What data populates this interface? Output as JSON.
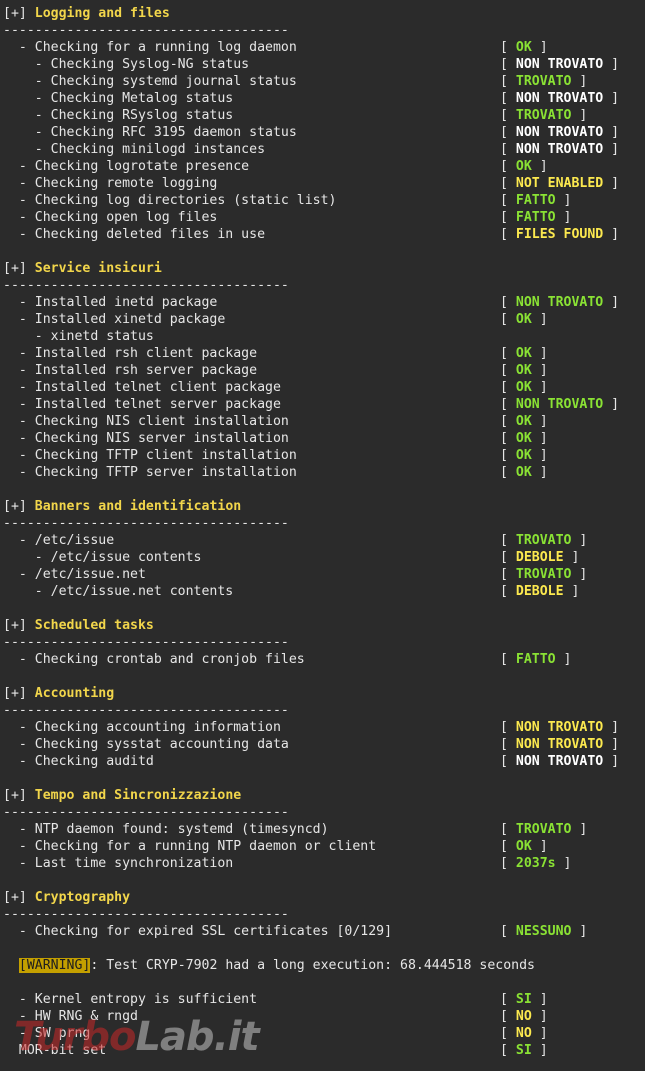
{
  "sections": [
    {
      "tag": "[+]",
      "title": "Logging and files",
      "rule": "------------------------------------",
      "items": [
        {
          "label": "  - Checking for a running log daemon",
          "status": "OK",
          "color": "green"
        },
        {
          "label": "    - Checking Syslog-NG status",
          "status": "NON TROVATO",
          "color": "white"
        },
        {
          "label": "    - Checking systemd journal status",
          "status": "TROVATO",
          "color": "green"
        },
        {
          "label": "    - Checking Metalog status",
          "status": "NON TROVATO",
          "color": "white"
        },
        {
          "label": "    - Checking RSyslog status",
          "status": "TROVATO",
          "color": "green"
        },
        {
          "label": "    - Checking RFC 3195 daemon status",
          "status": "NON TROVATO",
          "color": "white"
        },
        {
          "label": "    - Checking minilogd instances",
          "status": "NON TROVATO",
          "color": "white"
        },
        {
          "label": "  - Checking logrotate presence",
          "status": "OK",
          "color": "green"
        },
        {
          "label": "  - Checking remote logging",
          "status": "NOT ENABLED",
          "color": "yellow"
        },
        {
          "label": "  - Checking log directories (static list)",
          "status": "FATTO",
          "color": "green"
        },
        {
          "label": "  - Checking open log files",
          "status": "FATTO",
          "color": "green"
        },
        {
          "label": "  - Checking deleted files in use",
          "status": "FILES FOUND",
          "color": "yellow"
        }
      ]
    },
    {
      "tag": "[+]",
      "title": "Service insicuri",
      "rule": "------------------------------------",
      "items": [
        {
          "label": "  - Installed inetd package",
          "status": "NON TROVATO",
          "color": "green"
        },
        {
          "label": "  - Installed xinetd package",
          "status": "OK",
          "color": "green"
        },
        {
          "label": "    - xinetd status",
          "status": "",
          "color": "white"
        },
        {
          "label": "  - Installed rsh client package",
          "status": "OK",
          "color": "green"
        },
        {
          "label": "  - Installed rsh server package",
          "status": "OK",
          "color": "green"
        },
        {
          "label": "  - Installed telnet client package",
          "status": "OK",
          "color": "green"
        },
        {
          "label": "  - Installed telnet server package",
          "status": "NON TROVATO",
          "color": "green"
        },
        {
          "label": "  - Checking NIS client installation",
          "status": "OK",
          "color": "green"
        },
        {
          "label": "  - Checking NIS server installation",
          "status": "OK",
          "color": "green"
        },
        {
          "label": "  - Checking TFTP client installation",
          "status": "OK",
          "color": "green"
        },
        {
          "label": "  - Checking TFTP server installation",
          "status": "OK",
          "color": "green"
        }
      ]
    },
    {
      "tag": "[+]",
      "title": "Banners and identification",
      "rule": "------------------------------------",
      "items": [
        {
          "label": "  - /etc/issue",
          "status": "TROVATO",
          "color": "green"
        },
        {
          "label": "    - /etc/issue contents",
          "status": "DEBOLE",
          "color": "yellow"
        },
        {
          "label": "  - /etc/issue.net",
          "status": "TROVATO",
          "color": "green"
        },
        {
          "label": "    - /etc/issue.net contents",
          "status": "DEBOLE",
          "color": "yellow"
        }
      ]
    },
    {
      "tag": "[+]",
      "title": "Scheduled tasks",
      "rule": "------------------------------------",
      "items": [
        {
          "label": "  - Checking crontab and cronjob files",
          "status": "FATTO",
          "color": "green"
        }
      ]
    },
    {
      "tag": "[+]",
      "title": "Accounting",
      "rule": "------------------------------------",
      "items": [
        {
          "label": "  - Checking accounting information",
          "status": "NON TROVATO",
          "color": "yellow"
        },
        {
          "label": "  - Checking sysstat accounting data",
          "status": "NON TROVATO",
          "color": "yellow"
        },
        {
          "label": "  - Checking auditd",
          "status": "NON TROVATO",
          "color": "white"
        }
      ]
    },
    {
      "tag": "[+]",
      "title": "Tempo and Sincronizzazione",
      "rule": "------------------------------------",
      "items": [
        {
          "label": "  - NTP daemon found: systemd (timesyncd)",
          "status": "TROVATO",
          "color": "green"
        },
        {
          "label": "  - Checking for a running NTP daemon or client",
          "status": "OK",
          "color": "green"
        },
        {
          "label": "  - Last time synchronization",
          "status": "2037s",
          "color": "green"
        }
      ]
    },
    {
      "tag": "[+]",
      "title": "Cryptography",
      "rule": "------------------------------------",
      "items": [
        {
          "label": "  - Checking for expired SSL certificates [0/129]",
          "status": "NESSUNO",
          "color": "green"
        }
      ]
    }
  ],
  "warning": {
    "badge": "[WARNING]",
    "text": ": Test CRYP-7902 had a long execution: 68.444518 seconds"
  },
  "tail_items": [
    {
      "label": "  - Kernel entropy is sufficient",
      "status": "SI",
      "color": "green"
    },
    {
      "label": "  - HW RNG & rngd",
      "status": "NO",
      "color": "yellow"
    },
    {
      "label": "  - SW prng",
      "status": "NO",
      "color": "yellow"
    },
    {
      "label": "  MOR-bit set",
      "status": "SI",
      "color": "green"
    }
  ],
  "watermark": {
    "part1": "Turbo",
    "part2": "Lab.it"
  },
  "colors": {
    "background": "#2b2b2b",
    "text": "#e6e6e6",
    "header": "#f2d64b",
    "ok": "#8ae234",
    "warn": "#fce94f",
    "badge": "#c4a000"
  }
}
